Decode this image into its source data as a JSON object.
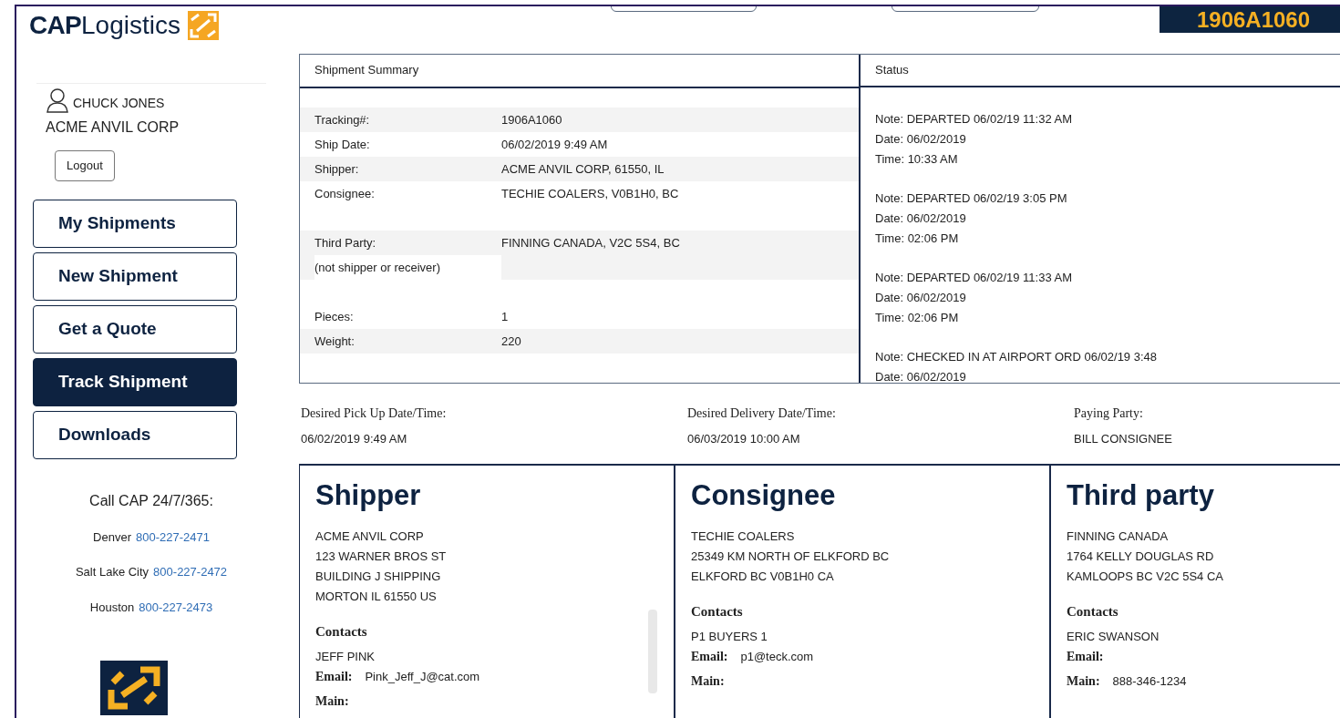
{
  "logo": {
    "bold": "CAP",
    "text": "Logistics"
  },
  "tracking_badge": "1906A1060",
  "user": {
    "name": "CHUCK JONES",
    "company": "ACME ANVIL CORP"
  },
  "logout": "Logout",
  "nav": [
    {
      "label": "My Shipments",
      "selected": false
    },
    {
      "label": "New Shipment",
      "selected": false
    },
    {
      "label": "Get a Quote",
      "selected": false
    },
    {
      "label": "Track Shipment",
      "selected": true
    },
    {
      "label": "Downloads",
      "selected": false
    }
  ],
  "call": {
    "title": "Call CAP 24/7/365:",
    "lines": [
      {
        "city": "Denver",
        "phone": "800-227-2471"
      },
      {
        "city": "Salt Lake City",
        "phone": "800-227-2472"
      },
      {
        "city": "Houston",
        "phone": "800-227-2473"
      }
    ]
  },
  "summary": {
    "title": "Shipment Summary",
    "rows": [
      {
        "label": "Tracking#:",
        "value": "1906A1060"
      },
      {
        "label": "Ship Date:",
        "value": "06/02/2019 9:49 AM"
      },
      {
        "label": "Shipper:",
        "value": "ACME ANVIL CORP, 61550, IL"
      },
      {
        "label": "Consignee:",
        "value": "TECHIE COALERS, V0B1H0, BC"
      },
      {
        "label": "Third Party:",
        "sublabel": "(not shipper or receiver)",
        "value": "FINNING CANADA, V2C 5S4, BC"
      },
      {
        "label": "Pieces:",
        "value": "1"
      },
      {
        "label": "Weight:",
        "value": "220"
      }
    ]
  },
  "status": {
    "title": "Status",
    "entries": [
      {
        "note": "Note: DEPARTED 06/02/19 11:32 AM",
        "date": "Date: 06/02/2019",
        "time": "Time: 10:33 AM"
      },
      {
        "note": "Note: DEPARTED 06/02/19 3:05 PM",
        "date": "Date: 06/02/2019",
        "time": "Time: 02:06 PM"
      },
      {
        "note": "Note: DEPARTED 06/02/19 11:33 AM",
        "date": "Date: 06/02/2019",
        "time": "Time: 02:06 PM"
      },
      {
        "note": "Note: CHECKED IN AT AIRPORT ORD 06/02/19 3:48",
        "date": "Date: 06/02/2019"
      }
    ]
  },
  "dates": [
    {
      "label": "Desired Pick Up Date/Time:",
      "value": "06/02/2019 9:49 AM"
    },
    {
      "label": "Desired Delivery Date/Time:",
      "value": "06/03/2019 10:00 AM"
    },
    {
      "label": "Paying Party:",
      "value": "BILL CONSIGNEE"
    }
  ],
  "parties": [
    {
      "title": "Shipper",
      "address": [
        "ACME ANVIL CORP",
        "123 WARNER BROS ST",
        "BUILDING J SHIPPING",
        "MORTON IL 61550 US"
      ],
      "contacts_title": "Contacts",
      "contact_name": "JEFF PINK",
      "fields": [
        {
          "label": "Email:",
          "value": "Pink_Jeff_J@cat.com"
        },
        {
          "label": "Main:"
        }
      ]
    },
    {
      "title": "Consignee",
      "address": [
        "TECHIE COALERS",
        "25349 KM NORTH OF ELKFORD BC",
        "ELKFORD BC V0B1H0 CA"
      ],
      "contacts_title": "Contacts",
      "contact_name": "P1 BUYERS 1",
      "fields": [
        {
          "label": "Email:",
          "value": "p1@teck.com"
        },
        {
          "label": "Main:"
        }
      ]
    },
    {
      "title": "Third party",
      "address": [
        "FINNING CANADA",
        "1764 KELLY DOUGLAS RD",
        "KAMLOOPS BC V2C 5S4 CA"
      ],
      "contacts_title": "Contacts",
      "contact_name": "ERIC SWANSON",
      "fields": [
        {
          "label": "Email:"
        },
        {
          "label": "Main:",
          "value": "888-346-1234"
        }
      ]
    }
  ]
}
